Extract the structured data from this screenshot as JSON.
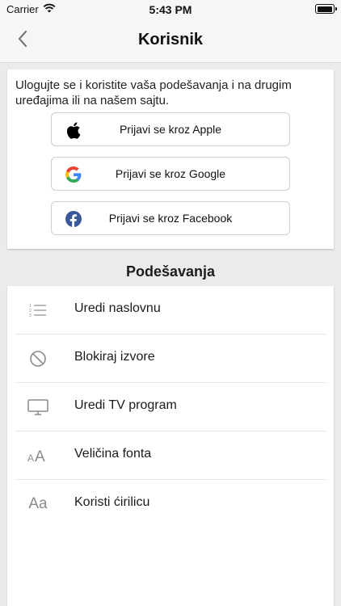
{
  "status_bar": {
    "carrier": "Carrier",
    "time": "5:43 PM"
  },
  "nav": {
    "title": "Korisnik",
    "back_icon": "chevron-left-icon"
  },
  "login": {
    "description": "Ulogujte se i koristite vaša podešavanja i na drugim uređajima ili na našem sajtu.",
    "buttons": [
      {
        "label": "Prijavi se kroz Apple",
        "icon": "apple-icon"
      },
      {
        "label": "Prijavi se kroz Google",
        "icon": "google-icon"
      },
      {
        "label": "Prijavi se kroz Facebook",
        "icon": "facebook-icon"
      }
    ]
  },
  "settings": {
    "title": "Podešavanja",
    "items": [
      {
        "label": "Uredi naslovnu",
        "icon": "numbered-list-icon"
      },
      {
        "label": "Blokiraj izvore",
        "icon": "block-icon"
      },
      {
        "label": "Uredi TV program",
        "icon": "tv-icon"
      },
      {
        "label": "Veličina fonta",
        "icon": "font-size-icon",
        "icon_text": "AA"
      },
      {
        "label": "Koristi ćirilicu",
        "icon": "alphabet-icon",
        "icon_text": "Aa"
      }
    ]
  },
  "colors": {
    "accent_google_blue": "#4285F4",
    "facebook_blue": "#3b5998"
  }
}
